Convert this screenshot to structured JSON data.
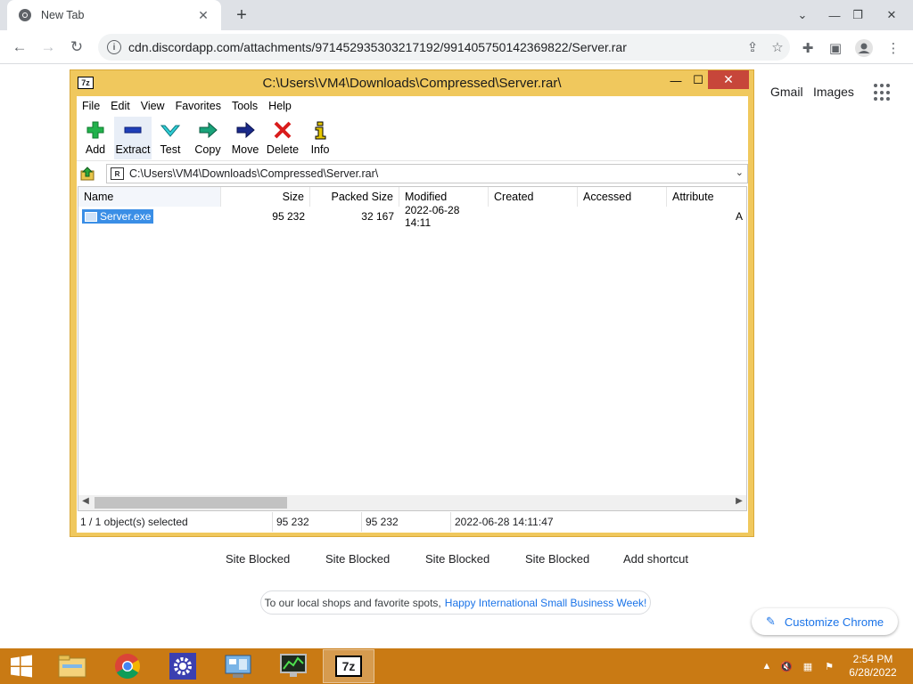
{
  "chrome": {
    "tab_title": "New Tab",
    "url": "cdn.discordapp.com/attachments/971452935303217192/991405750142369822/Server.rar"
  },
  "ntp": {
    "gmail": "Gmail",
    "images": "Images",
    "shortcuts": [
      "Site Blocked",
      "Site Blocked",
      "Site Blocked",
      "Site Blocked",
      "Add shortcut"
    ],
    "promo_text": "To our local shops and favorite spots,",
    "promo_link": "Happy International Small Business Week!",
    "customize": "Customize Chrome"
  },
  "sevenzip": {
    "logo": "7z",
    "title": "C:\\Users\\VM4\\Downloads\\Compressed\\Server.rar\\",
    "menu": [
      "File",
      "Edit",
      "View",
      "Favorites",
      "Tools",
      "Help"
    ],
    "tools": [
      "Add",
      "Extract",
      "Test",
      "Copy",
      "Move",
      "Delete",
      "Info"
    ],
    "path": "C:\\Users\\VM4\\Downloads\\Compressed\\Server.rar\\",
    "columns": [
      "Name",
      "Size",
      "Packed Size",
      "Modified",
      "Created",
      "Accessed",
      "Attribute"
    ],
    "rows": [
      {
        "name": "Server.exe",
        "size": "95 232",
        "packed": "32 167",
        "modified": "2022-06-28 14:11",
        "created": "",
        "accessed": "",
        "attr": "A"
      }
    ],
    "status": {
      "selected": "1 / 1 object(s) selected",
      "size": "95 232",
      "packed": "95 232",
      "modified": "2022-06-28 14:11:47"
    }
  },
  "taskbar": {
    "time": "2:54 PM",
    "date": "6/28/2022",
    "active_app_label": "7z"
  }
}
